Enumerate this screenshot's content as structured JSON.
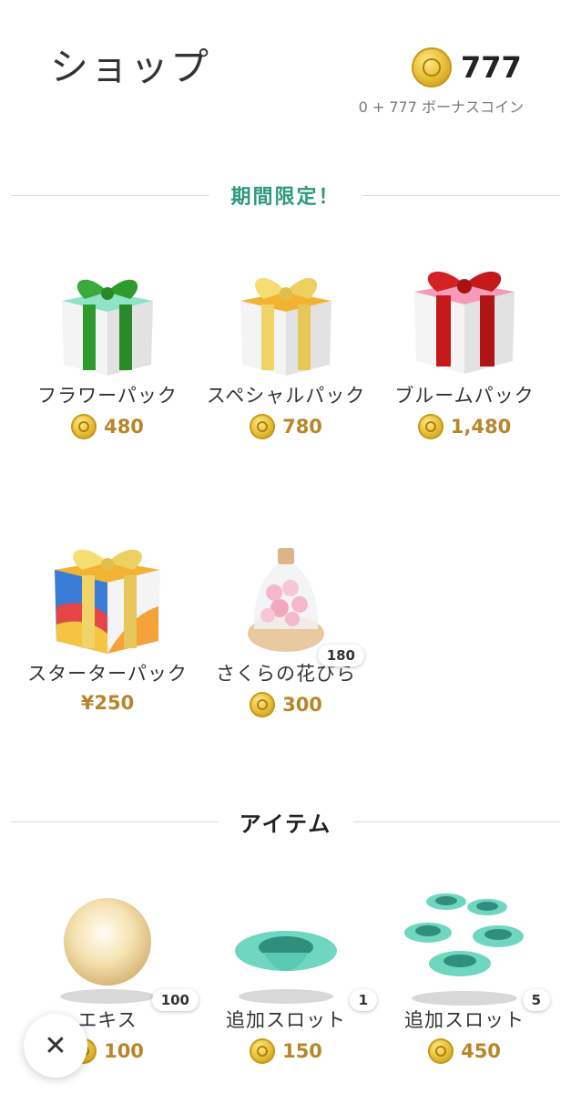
{
  "header": {
    "title": "ショップ",
    "coin_balance": "777",
    "bonus_text": "0 + 777 ボーナスコイン"
  },
  "sections": {
    "limited_label": "期間限定！",
    "items_label": "アイテム"
  },
  "limited_products": [
    {
      "name": "フラワーパック",
      "price": "480",
      "currency": "coin",
      "icon": "gift-box-green-icon"
    },
    {
      "name": "スペシャルパック",
      "price": "780",
      "currency": "coin",
      "icon": "gift-box-yellow-icon"
    },
    {
      "name": "ブルームパック",
      "price": "1,480",
      "currency": "coin",
      "icon": "gift-box-red-icon"
    },
    {
      "name": "スターターパック",
      "price": "¥250",
      "currency": "yen",
      "icon": "gift-box-rainbow-icon"
    },
    {
      "name": "さくらの花びら",
      "price": "300",
      "currency": "coin",
      "badge": "180",
      "icon": "sakura-bottle-icon"
    }
  ],
  "item_products": [
    {
      "name": "エキス",
      "price": "100",
      "currency": "coin",
      "badge": "100",
      "icon": "pearl-orb-icon"
    },
    {
      "name": "追加スロット",
      "price": "150",
      "currency": "coin",
      "badge": "1",
      "icon": "slot-dish-icon"
    },
    {
      "name": "追加スロット",
      "price": "450",
      "currency": "coin",
      "badge": "5",
      "icon": "slot-dishes-icon"
    }
  ],
  "close_label": "✕",
  "colors": {
    "accent_green": "#2e9a7f",
    "price_gold": "#b8862a",
    "coin_gold": "#e9c13b",
    "teal_dish": "#5bc9b2"
  }
}
